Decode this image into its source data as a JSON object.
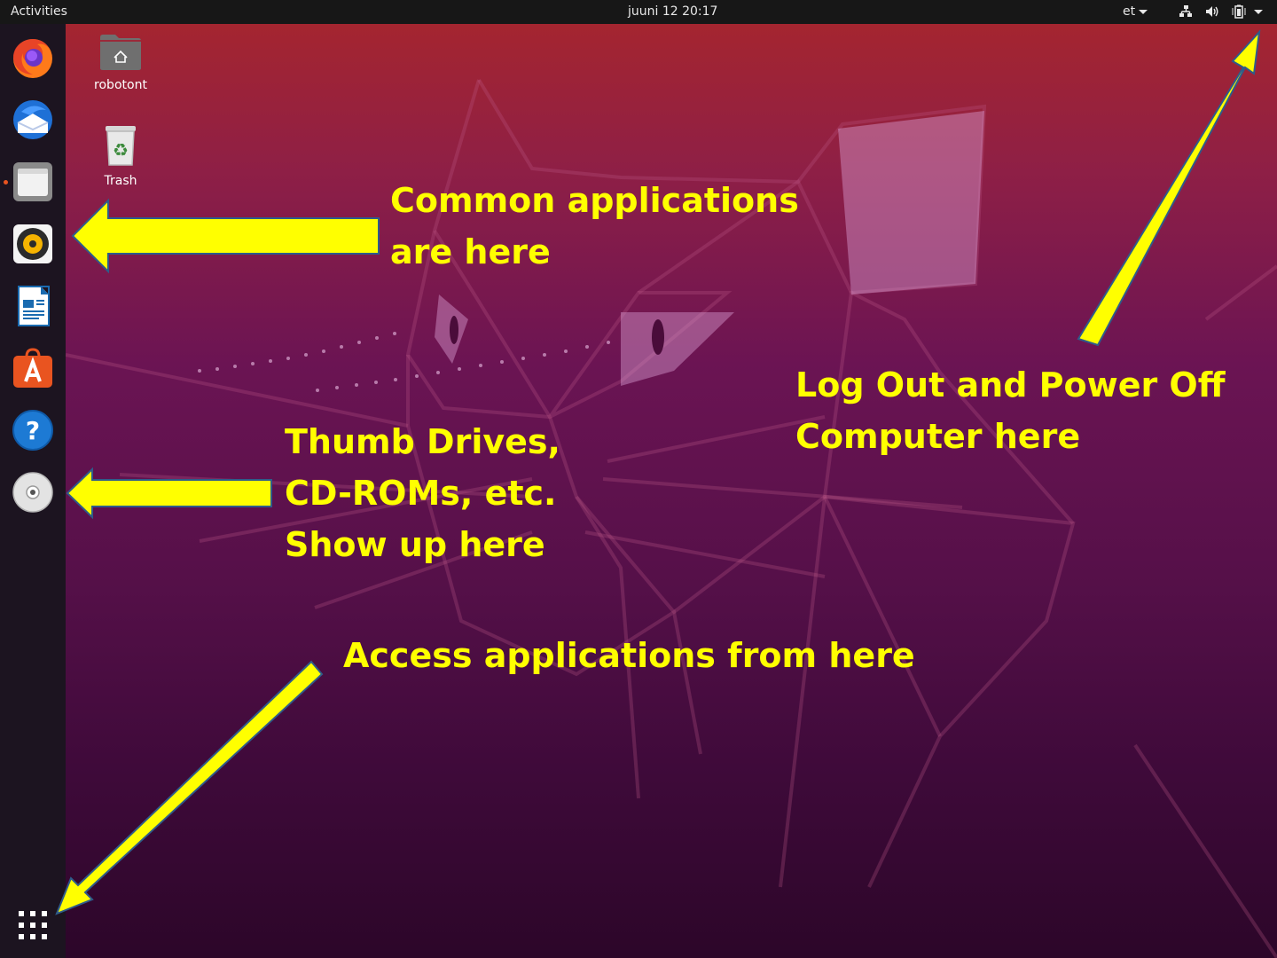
{
  "topbar": {
    "activities": "Activities",
    "clock": "juuni 12  20:17",
    "input_language": "et",
    "tray_icons": [
      "network-icon",
      "volume-icon",
      "battery-icon",
      "system-menu-icon"
    ]
  },
  "dock": {
    "items": [
      {
        "name": "firefox",
        "icon": "firefox-icon"
      },
      {
        "name": "thunderbird",
        "icon": "thunderbird-icon"
      },
      {
        "name": "files",
        "icon": "files-icon",
        "running": true
      },
      {
        "name": "rhythmbox",
        "icon": "rhythmbox-icon"
      },
      {
        "name": "libreoffice-writer",
        "icon": "writer-icon"
      },
      {
        "name": "ubuntu-software",
        "icon": "software-icon"
      },
      {
        "name": "help",
        "icon": "help-icon"
      },
      {
        "name": "optical-drive",
        "icon": "cd-icon"
      }
    ],
    "show_applications_icon": "app-grid-icon"
  },
  "desktop": {
    "icons": [
      {
        "label": "robotont",
        "icon": "home-folder-icon"
      },
      {
        "label": "Trash",
        "icon": "trash-icon"
      }
    ]
  },
  "callouts": {
    "common_apps": [
      "Common applications",
      "are here"
    ],
    "drives": [
      "Thumb Drives,",
      "CD-ROMs, etc.",
      "Show up here"
    ],
    "access_apps": "Access applications from here",
    "power_off": [
      "Log Out and Power Off",
      "Computer here"
    ]
  },
  "colors": {
    "callout_text": "#ffff00",
    "arrow_fill": "#ffff00",
    "accent": "#e95420",
    "topbar_bg": "#171717"
  }
}
